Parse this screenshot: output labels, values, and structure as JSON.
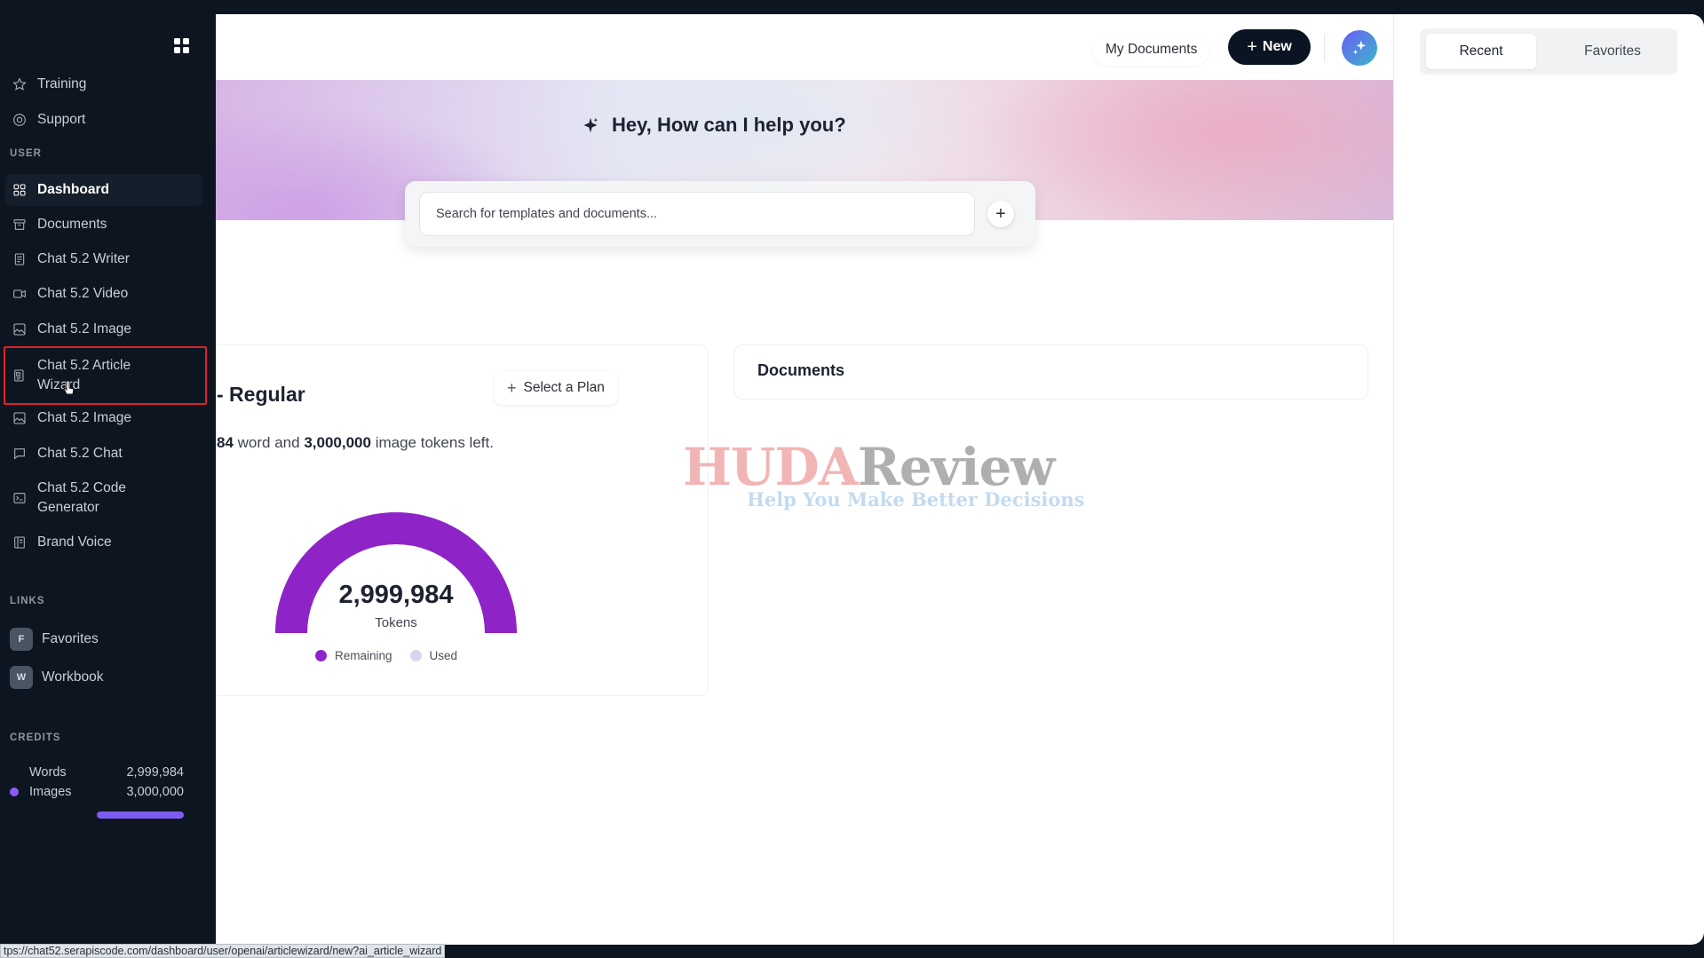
{
  "sidebar": {
    "top_items": [
      {
        "label": "Training",
        "icon": "star-icon"
      },
      {
        "label": "Support",
        "icon": "lifebuoy-icon"
      }
    ],
    "user_section_label": "USER",
    "user_items": [
      {
        "label": "Dashboard",
        "icon": "dashboard-icon",
        "active": true
      },
      {
        "label": "Documents",
        "icon": "archive-icon"
      },
      {
        "label": "Chat 5.2 Writer",
        "icon": "document-icon"
      },
      {
        "label": "Chat 5.2 Video",
        "icon": "video-icon"
      },
      {
        "label": "Chat 5.2 Image",
        "icon": "image-icon"
      },
      {
        "label": "Chat 5.2 Article Wizard",
        "icon": "article-icon",
        "highlighted": true
      },
      {
        "label": "Chat 5.2 Image",
        "icon": "image-icon"
      },
      {
        "label": "Chat 5.2 Chat",
        "icon": "chat-icon"
      },
      {
        "label": "Chat 5.2 Code Generator",
        "icon": "terminal-icon"
      },
      {
        "label": "Brand Voice",
        "icon": "book-icon"
      }
    ],
    "links_section_label": "LINKS",
    "links": [
      {
        "badge": "F",
        "label": "Favorites"
      },
      {
        "badge": "W",
        "label": "Workbook"
      }
    ],
    "credits_section_label": "CREDITS",
    "credits": [
      {
        "label": "Words",
        "value": "2,999,984"
      },
      {
        "label": "Images",
        "value": "3,000,000"
      }
    ],
    "accent_color": "#8b5cf6"
  },
  "topbar": {
    "my_documents_label": "My Documents",
    "new_button_label": "New"
  },
  "hero": {
    "title": "Hey, How can I help you?",
    "search_placeholder": "Search for templates and documents..."
  },
  "plan": {
    "title": "- Regular",
    "select_plan_label": "Select a Plan",
    "word_tokens": "84",
    "word_text": "word and",
    "image_tokens": "3,000,000",
    "image_text": "image tokens left.",
    "gauge": {
      "value": "2,999,984",
      "unit_label": "Tokens",
      "remaining_fraction": 1.0,
      "remaining_label": "Remaining",
      "used_label": "Used",
      "remaining_color": "#8e24c8",
      "used_color": "#dcd3ea"
    }
  },
  "documents": {
    "title": "Documents"
  },
  "watermark": {
    "part1": "HUDA",
    "part2": "Review",
    "tagline": "Help You Make Better Decisions"
  },
  "right_panel": {
    "tabs": [
      {
        "label": "Recent",
        "active": true
      },
      {
        "label": "Favorites",
        "active": false
      }
    ]
  },
  "statusbar": {
    "url": "tps://chat52.serapiscode.com/dashboard/user/openai/articlewizard/new?ai_article_wizard"
  }
}
